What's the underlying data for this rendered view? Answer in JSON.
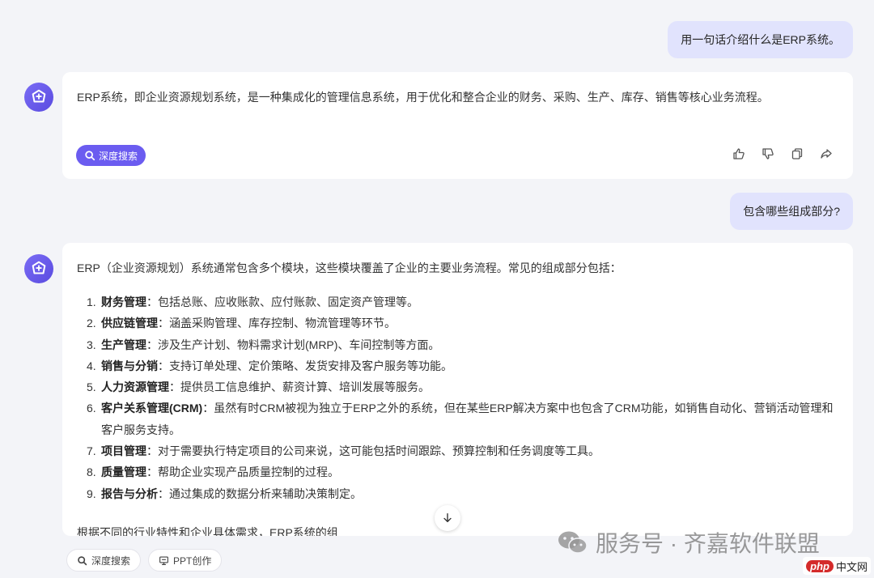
{
  "conversation": {
    "user_msg_1": "用一句话介绍什么是ERP系统。",
    "answer_1": "ERP系统，即企业资源规划系统，是一种集成化的管理信息系统，用于优化和整合企业的财务、采购、生产、库存、销售等核心业务流程。",
    "deep_search_label": "深度搜索",
    "user_msg_2": "包含哪些组成部分?",
    "answer_2_intro": "ERP（企业资源规划）系统通常包含多个模块，这些模块覆盖了企业的主要业务流程。常见的组成部分包括：",
    "answer_2_items": [
      {
        "num": "1.",
        "title": "财务管理",
        "desc": "：包括总账、应收账款、应付账款、固定资产管理等。"
      },
      {
        "num": "2.",
        "title": "供应链管理",
        "desc": "：涵盖采购管理、库存控制、物流管理等环节。"
      },
      {
        "num": "3.",
        "title": "生产管理",
        "desc": "：涉及生产计划、物料需求计划(MRP)、车间控制等方面。"
      },
      {
        "num": "4.",
        "title": "销售与分销",
        "desc": "：支持订单处理、定价策略、发货安排及客户服务等功能。"
      },
      {
        "num": "5.",
        "title": "人力资源管理",
        "desc": "：提供员工信息维护、薪资计算、培训发展等服务。"
      },
      {
        "num": "6.",
        "title": "客户关系管理(CRM)",
        "desc": "：虽然有时CRM被视为独立于ERP之外的系统，但在某些ERP解决方案中也包含了CRM功能，如销售自动化、营销活动管理和客户服务支持。"
      },
      {
        "num": "7.",
        "title": "项目管理",
        "desc": "：对于需要执行特定项目的公司来说，这可能包括时间跟踪、预算控制和任务调度等工具。"
      },
      {
        "num": "8.",
        "title": "质量管理",
        "desc": "：帮助企业实现产品质量控制的过程。"
      },
      {
        "num": "9.",
        "title": "报告与分析",
        "desc": "：通过集成的数据分析来辅助决策制定。"
      }
    ],
    "answer_2_tail": "根据不同的行业特性和企业具体需求，ERP系统的组"
  },
  "bottom_bar": {
    "deep_search": "深度搜索",
    "ppt": "PPT创作"
  },
  "watermark": {
    "text": "服务号 · 齐嘉软件联盟"
  },
  "corner_badge": {
    "php": "php",
    "cn": "中文网"
  },
  "colors": {
    "accent": "#6b5cf0",
    "user_bubble": "#e1e3fd",
    "background": "#f3f4f8"
  },
  "icons": [
    "assistant-logo-icon",
    "search-icon",
    "thumbs-up-icon",
    "thumbs-down-icon",
    "copy-icon",
    "share-icon",
    "arrow-down-icon",
    "ppt-icon",
    "wechat-icon"
  ]
}
